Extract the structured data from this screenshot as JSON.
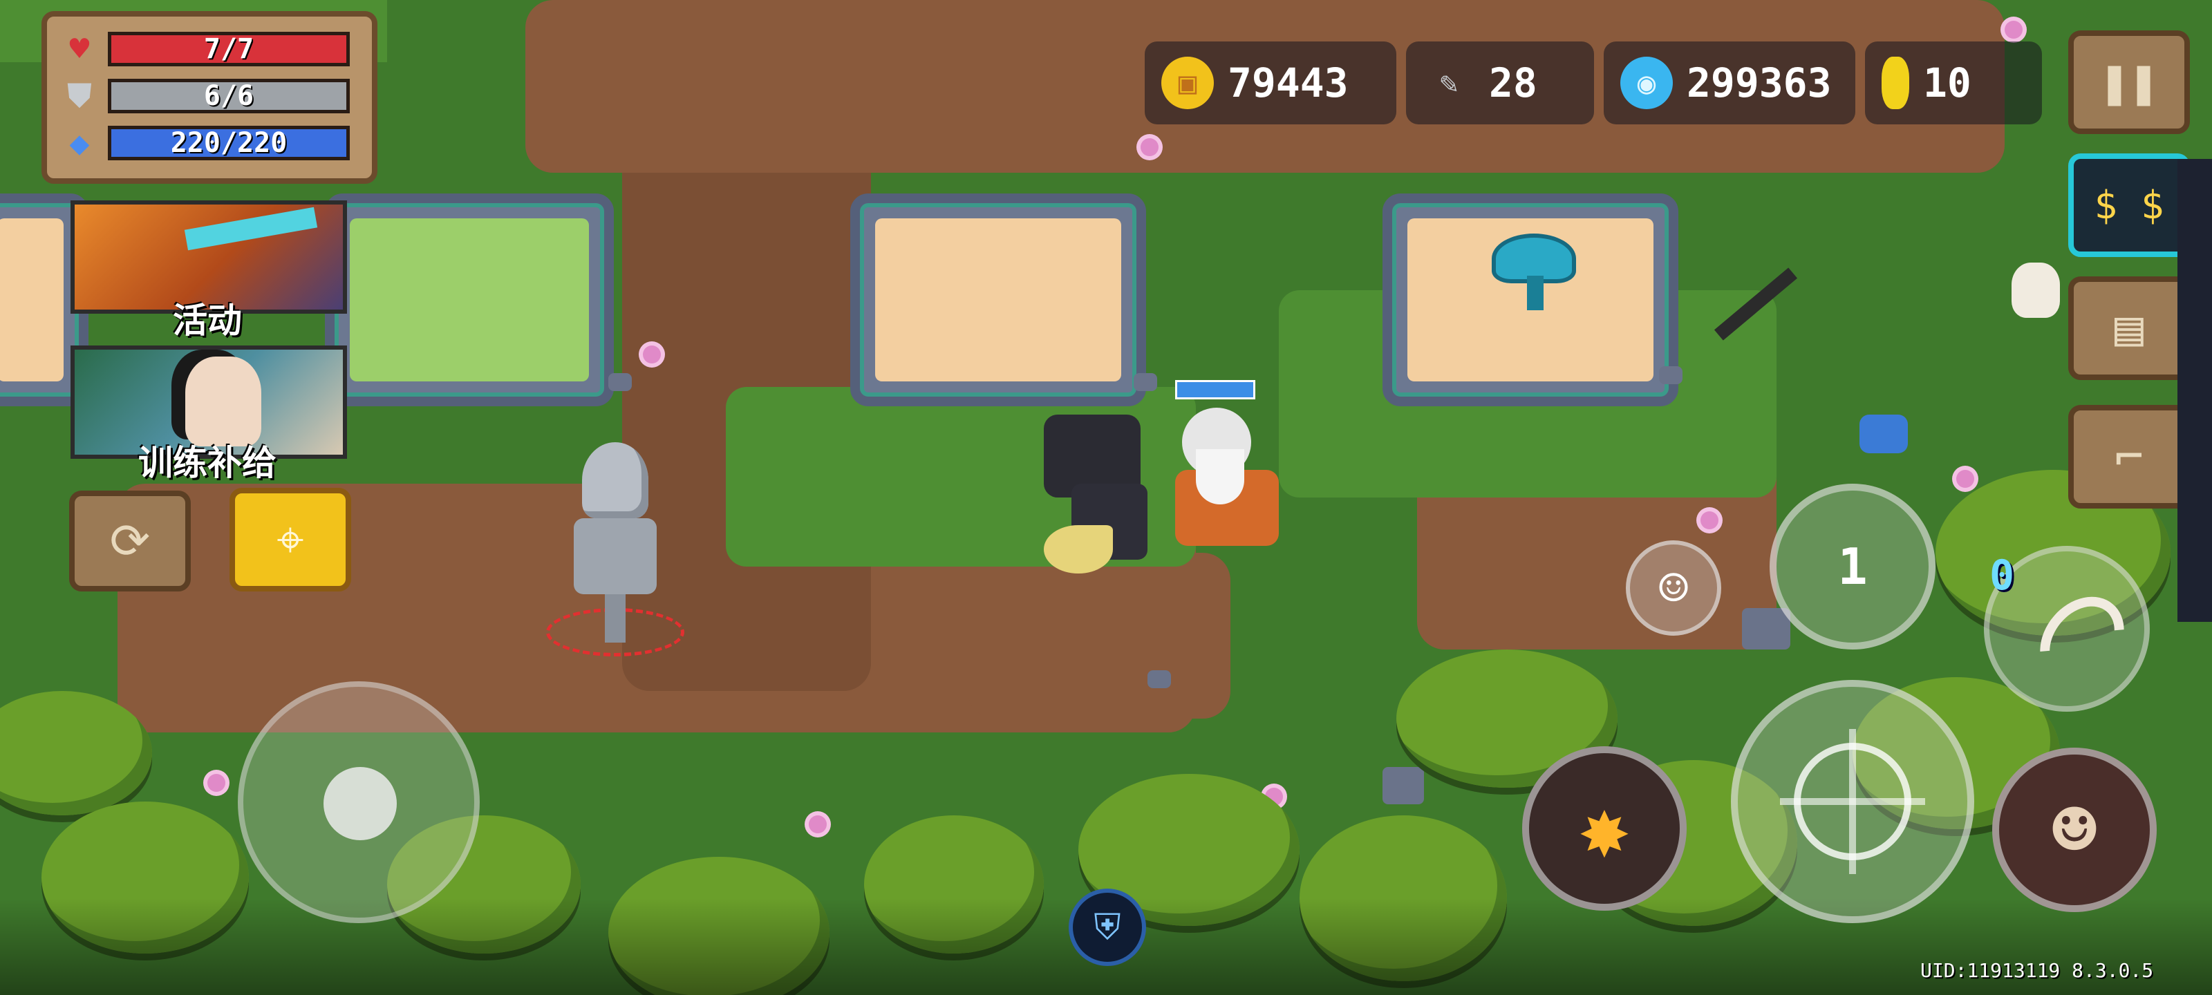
{
  "hud": {
    "health": {
      "text": "7/7",
      "value": 7,
      "max": 7,
      "color": "#d8323a"
    },
    "armor": {
      "text": "6/6",
      "value": 6,
      "max": 6,
      "color": "#9ea3a8"
    },
    "energy": {
      "text": "220/220",
      "value": 220,
      "max": 220,
      "color": "#3b6fe0"
    }
  },
  "currency": {
    "gold": "79443",
    "fish": "28",
    "gems": "299363",
    "tokens": "10"
  },
  "promos": {
    "event_label": "活动",
    "supply_label": "训练补给"
  },
  "footer": {
    "uid": "UID:11913119 8.3.0.5"
  },
  "controls": {
    "skill_cooldown": "1",
    "weapon_ammo": "0"
  },
  "icons": {
    "health": "heart-icon",
    "armor": "shield-icon",
    "energy": "diamond-icon",
    "gold": "coin-icon",
    "fish": "fish-icon",
    "gems": "gem-icon",
    "tokens": "token-icon",
    "pause": "pause-icon",
    "shop": "money-face-icon",
    "profile": "profile-card-icon",
    "stairs": "stairs-icon",
    "refresh": "refresh-icon",
    "location": "location-pin-icon",
    "emote": "smiley-icon",
    "skill": "fire-skill-icon",
    "attack": "crosshair-icon",
    "character": "character-portrait-icon",
    "buff": "shield-badge-icon"
  },
  "colors": {
    "accent_yellow": "#f2c21b",
    "panel_wood": "#9b7a55",
    "shop_cyan": "#27c8d8"
  }
}
